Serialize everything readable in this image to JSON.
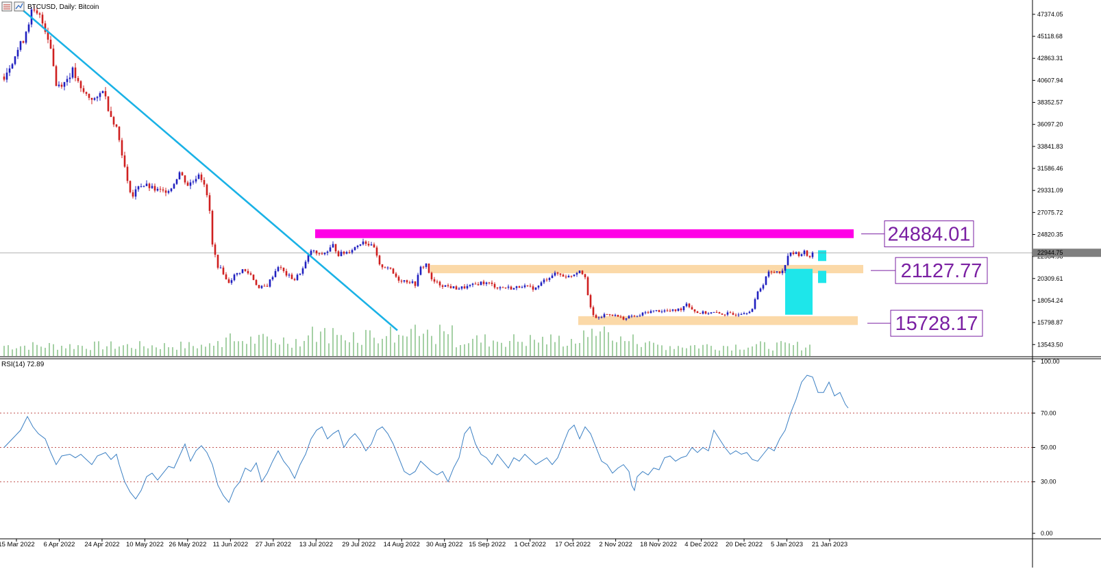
{
  "header": {
    "symbol_label": "BTCUSD, Daily:  Bitcoin",
    "icons": [
      "list-icon",
      "chart-icon"
    ]
  },
  "indicator": {
    "label": "RSI(14) 72.89"
  },
  "colors": {
    "bull": "#1f1fbf",
    "bear": "#cf1f1f",
    "volume": "#4aa04a",
    "trendline": "#1ab2e6",
    "resistance": "#ff00e6",
    "zone": "#fbd9a8",
    "breakout": "#1ee6ea",
    "rsi_line": "#3a7fc3",
    "rsi_level": "#c0504d",
    "level_text": "#7a1fa2",
    "current_price_line": "#808080"
  },
  "chart_data": [
    {
      "type": "candlestick",
      "title": "BTCUSD, Daily:  Bitcoin",
      "ylim": [
        12300,
        48700
      ],
      "y_ticks": [
        "47374.05",
        "45118.68",
        "42863.31",
        "40607.94",
        "38352.57",
        "36097.20",
        "33841.83",
        "31586.46",
        "29331.09",
        "27075.72",
        "24820.35",
        "22564.98",
        "20309.61",
        "18054.24",
        "15798.87",
        "13543.50"
      ],
      "current_price_label": "22944.75",
      "current_price": 22944.75,
      "x_labels": [
        "15 Mar 2022",
        "6 Apr 2022",
        "24 Apr 2022",
        "10 May 2022",
        "26 May 2022",
        "11 Jun 2022",
        "27 Jun 2022",
        "13 Jul 2022",
        "29 Jul 2022",
        "14 Aug 2022",
        "30 Aug 2022",
        "15 Sep 2022",
        "1 Oct 2022",
        "17 Oct 2022",
        "2 Nov 2022",
        "18 Nov 2022",
        "4 Dec 2022",
        "20 Dec 2022",
        "5 Jan 2023",
        "21 Jan 2023"
      ],
      "price_path": [
        [
          0,
          41000
        ],
        [
          8,
          43200
        ],
        [
          14,
          44800
        ],
        [
          20,
          47600
        ],
        [
          26,
          47100
        ],
        [
          30,
          45900
        ],
        [
          34,
          44100
        ],
        [
          38,
          40100
        ],
        [
          44,
          40400
        ],
        [
          50,
          41600
        ],
        [
          56,
          39600
        ],
        [
          62,
          38900
        ],
        [
          68,
          38600
        ],
        [
          72,
          39800
        ],
        [
          77,
          37300
        ],
        [
          82,
          35800
        ],
        [
          86,
          33200
        ],
        [
          90,
          30100
        ],
        [
          94,
          28700
        ],
        [
          98,
          29900
        ],
        [
          104,
          29800
        ],
        [
          110,
          29400
        ],
        [
          116,
          29200
        ],
        [
          122,
          29600
        ],
        [
          128,
          31200
        ],
        [
          134,
          29900
        ],
        [
          138,
          30300
        ],
        [
          142,
          31100
        ],
        [
          146,
          30100
        ],
        [
          150,
          27200
        ],
        [
          152,
          23700
        ],
        [
          156,
          21600
        ],
        [
          160,
          20900
        ],
        [
          163,
          19800
        ],
        [
          168,
          20600
        ],
        [
          174,
          21200
        ],
        [
          180,
          20700
        ],
        [
          186,
          19300
        ],
        [
          192,
          19600
        ],
        [
          196,
          20600
        ],
        [
          200,
          21600
        ],
        [
          206,
          20700
        ],
        [
          212,
          20200
        ],
        [
          218,
          21300
        ],
        [
          224,
          23200
        ],
        [
          230,
          22700
        ],
        [
          236,
          23100
        ],
        [
          240,
          23700
        ],
        [
          244,
          22800
        ],
        [
          250,
          23000
        ],
        [
          256,
          23500
        ],
        [
          262,
          24200
        ],
        [
          266,
          23800
        ],
        [
          270,
          23400
        ],
        [
          274,
          21600
        ],
        [
          280,
          21500
        ],
        [
          284,
          20800
        ],
        [
          288,
          20200
        ],
        [
          296,
          20000
        ],
        [
          300,
          19700
        ],
        [
          304,
          21400
        ],
        [
          308,
          21800
        ],
        [
          312,
          20100
        ],
        [
          318,
          19700
        ],
        [
          324,
          19500
        ],
        [
          330,
          19300
        ],
        [
          336,
          19400
        ],
        [
          342,
          19600
        ],
        [
          348,
          19900
        ],
        [
          354,
          19800
        ],
        [
          360,
          19400
        ],
        [
          366,
          19400
        ],
        [
          372,
          19300
        ],
        [
          378,
          19600
        ],
        [
          382,
          19400
        ],
        [
          388,
          19300
        ],
        [
          394,
          20100
        ],
        [
          400,
          20700
        ],
        [
          404,
          20800
        ],
        [
          408,
          20600
        ],
        [
          412,
          20500
        ],
        [
          416,
          20800
        ],
        [
          420,
          21200
        ],
        [
          424,
          20600
        ],
        [
          427,
          17600
        ],
        [
          430,
          16500
        ],
        [
          434,
          16200
        ],
        [
          438,
          16600
        ],
        [
          442,
          16700
        ],
        [
          446,
          16500
        ],
        [
          450,
          16300
        ],
        [
          454,
          16200
        ],
        [
          458,
          16500
        ],
        [
          462,
          16400
        ],
        [
          466,
          16700
        ],
        [
          470,
          16900
        ],
        [
          476,
          17000
        ],
        [
          482,
          17000
        ],
        [
          488,
          17000
        ],
        [
          494,
          17200
        ],
        [
          498,
          17800
        ],
        [
          502,
          17200
        ],
        [
          506,
          16800
        ],
        [
          512,
          16800
        ],
        [
          518,
          16800
        ],
        [
          522,
          16700
        ],
        [
          528,
          16700
        ],
        [
          532,
          16600
        ],
        [
          538,
          16800
        ],
        [
          542,
          16900
        ],
        [
          546,
          17200
        ],
        [
          550,
          18900
        ],
        [
          554,
          19800
        ],
        [
          557,
          20900
        ],
        [
          560,
          20900
        ],
        [
          564,
          21100
        ],
        [
          568,
          21000
        ],
        [
          572,
          22700
        ],
        [
          576,
          22900
        ],
        [
          580,
          22800
        ],
        [
          584,
          23000
        ],
        [
          587,
          22500
        ],
        [
          590,
          22900
        ]
      ],
      "volume_base_note": "volume histogram along bottom of price panel",
      "annotations": {
        "trendline": {
          "from": [
            12,
            48000
          ],
          "to": [
            287,
            15000
          ]
        },
        "resistance_band": {
          "from_x": 227,
          "to_x": 620,
          "low": 24450,
          "high": 25350,
          "label": "24884.01"
        },
        "zone_mid": {
          "from_x": 311,
          "to_x": 627,
          "low": 20850,
          "high": 21700,
          "label": "21127.77"
        },
        "zone_low": {
          "from_x": 419,
          "to_x": 623,
          "low": 15550,
          "high": 16450,
          "label": "15728.17"
        },
        "breakout_box": {
          "from_x": 570,
          "to_x": 590,
          "low": 16600,
          "high": 21300
        },
        "breakout_small_boxes": [
          {
            "from_x": 594,
            "to_x": 600,
            "low": 22100,
            "high": 23200
          },
          {
            "from_x": 594,
            "to_x": 600,
            "low": 19850,
            "high": 21100
          }
        ]
      }
    },
    {
      "type": "line",
      "title": "RSI(14) 72.89",
      "ylim": [
        0,
        100
      ],
      "y_ticks": [
        "100.00",
        "70.00",
        "50.00",
        "30.00",
        "0.00"
      ],
      "levels": [
        70,
        50,
        30
      ],
      "series": [
        {
          "values": [
            [
              0,
              50
            ],
            [
              6,
              55
            ],
            [
              12,
              60
            ],
            [
              17,
              68
            ],
            [
              21,
              62
            ],
            [
              25,
              58
            ],
            [
              30,
              55
            ],
            [
              34,
              47
            ],
            [
              38,
              40
            ],
            [
              42,
              45
            ],
            [
              48,
              46
            ],
            [
              52,
              44
            ],
            [
              56,
              46
            ],
            [
              60,
              43
            ],
            [
              64,
              40
            ],
            [
              68,
              45
            ],
            [
              74,
              47
            ],
            [
              78,
              43
            ],
            [
              82,
              46
            ],
            [
              84,
              40
            ],
            [
              88,
              30
            ],
            [
              92,
              24
            ],
            [
              96,
              20
            ],
            [
              100,
              25
            ],
            [
              104,
              33
            ],
            [
              108,
              35
            ],
            [
              112,
              31
            ],
            [
              116,
              35
            ],
            [
              120,
              39
            ],
            [
              124,
              38
            ],
            [
              128,
              45
            ],
            [
              132,
              52
            ],
            [
              136,
              42
            ],
            [
              140,
              48
            ],
            [
              144,
              51
            ],
            [
              148,
              47
            ],
            [
              152,
              40
            ],
            [
              156,
              28
            ],
            [
              160,
              22
            ],
            [
              164,
              18
            ],
            [
              168,
              26
            ],
            [
              172,
              30
            ],
            [
              176,
              38
            ],
            [
              180,
              36
            ],
            [
              184,
              41
            ],
            [
              188,
              30
            ],
            [
              192,
              35
            ],
            [
              196,
              42
            ],
            [
              200,
              48
            ],
            [
              204,
              42
            ],
            [
              208,
              38
            ],
            [
              212,
              32
            ],
            [
              216,
              40
            ],
            [
              220,
              46
            ],
            [
              224,
              55
            ],
            [
              228,
              60
            ],
            [
              232,
              62
            ],
            [
              236,
              55
            ],
            [
              240,
              58
            ],
            [
              244,
              60
            ],
            [
              248,
              50
            ],
            [
              252,
              55
            ],
            [
              256,
              58
            ],
            [
              260,
              54
            ],
            [
              264,
              48
            ],
            [
              268,
              52
            ],
            [
              272,
              60
            ],
            [
              276,
              62
            ],
            [
              280,
              58
            ],
            [
              284,
              52
            ],
            [
              288,
              44
            ],
            [
              292,
              36
            ],
            [
              296,
              34
            ],
            [
              300,
              36
            ],
            [
              304,
              42
            ],
            [
              308,
              39
            ],
            [
              312,
              36
            ],
            [
              316,
              34
            ],
            [
              320,
              36
            ],
            [
              324,
              30
            ],
            [
              328,
              38
            ],
            [
              332,
              44
            ],
            [
              336,
              58
            ],
            [
              340,
              62
            ],
            [
              344,
              52
            ],
            [
              348,
              46
            ],
            [
              352,
              44
            ],
            [
              356,
              40
            ],
            [
              360,
              46
            ],
            [
              364,
              42
            ],
            [
              368,
              38
            ],
            [
              372,
              44
            ],
            [
              376,
              42
            ],
            [
              380,
              46
            ],
            [
              384,
              43
            ],
            [
              388,
              40
            ],
            [
              392,
              42
            ],
            [
              396,
              44
            ],
            [
              400,
              40
            ],
            [
              404,
              44
            ],
            [
              408,
              52
            ],
            [
              412,
              60
            ],
            [
              416,
              63
            ],
            [
              420,
              55
            ],
            [
              424,
              62
            ],
            [
              428,
              58
            ],
            [
              432,
              50
            ],
            [
              436,
              42
            ],
            [
              440,
              40
            ],
            [
              444,
              35
            ],
            [
              448,
              38
            ],
            [
              452,
              40
            ],
            [
              456,
              36
            ],
            [
              458,
              28
            ],
            [
              460,
              25
            ],
            [
              462,
              33
            ],
            [
              466,
              36
            ],
            [
              470,
              34
            ],
            [
              474,
              38
            ],
            [
              478,
              37
            ],
            [
              482,
              44
            ],
            [
              486,
              45
            ],
            [
              490,
              42
            ],
            [
              494,
              44
            ],
            [
              498,
              45
            ],
            [
              502,
              50
            ],
            [
              506,
              47
            ],
            [
              510,
              50
            ],
            [
              514,
              48
            ],
            [
              518,
              60
            ],
            [
              522,
              55
            ],
            [
              526,
              50
            ],
            [
              530,
              46
            ],
            [
              534,
              48
            ],
            [
              538,
              46
            ],
            [
              542,
              47
            ],
            [
              546,
              43
            ],
            [
              550,
              42
            ],
            [
              554,
              46
            ],
            [
              558,
              50
            ],
            [
              562,
              48
            ],
            [
              566,
              55
            ],
            [
              570,
              60
            ],
            [
              574,
              70
            ],
            [
              578,
              78
            ],
            [
              582,
              88
            ],
            [
              586,
              92
            ],
            [
              590,
              91
            ],
            [
              594,
              82
            ],
            [
              598,
              82
            ],
            [
              602,
              88
            ],
            [
              606,
              80
            ],
            [
              610,
              82
            ],
            [
              614,
              75
            ],
            [
              616,
              72.89
            ]
          ]
        }
      ]
    }
  ]
}
